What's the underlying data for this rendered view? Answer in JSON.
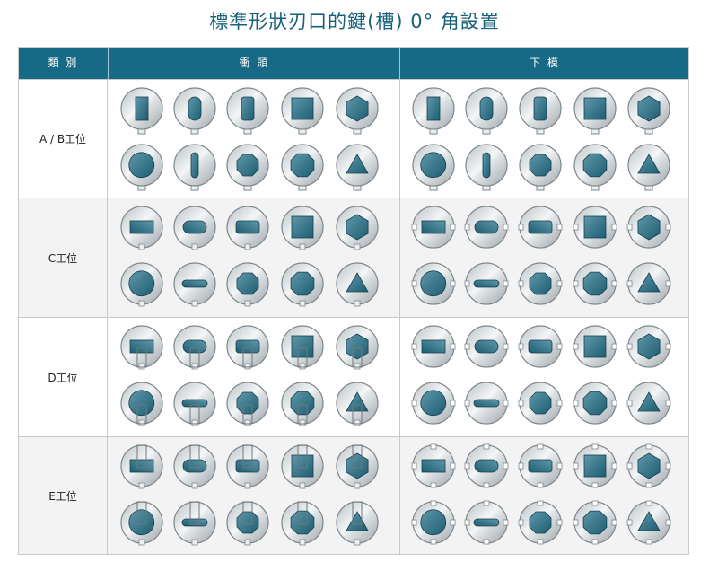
{
  "title": "標準形狀刃口的鍵(槽) 0° 角設置",
  "columns": {
    "category": "類 別",
    "punch": "衝 頭",
    "die": "下 模"
  },
  "shape_order": [
    "rect",
    "obround",
    "rounded-rect",
    "square",
    "hexagon",
    "round-flat",
    "slot",
    "octagon-small",
    "octagon",
    "triangle"
  ],
  "rows": [
    {
      "label": "A / B工位",
      "punch_style": "a",
      "die_style": "a"
    },
    {
      "label": "C工位",
      "punch_style": "c",
      "die_style": "c"
    },
    {
      "label": "D工位",
      "punch_style": "d",
      "die_style": "d"
    },
    {
      "label": "E工位",
      "punch_style": "e",
      "die_style": "e"
    }
  ],
  "colors": {
    "header_bg": "#176a86",
    "title": "#17617a",
    "shape_fill": "#2a6f86",
    "disc": "#d8dde0"
  }
}
